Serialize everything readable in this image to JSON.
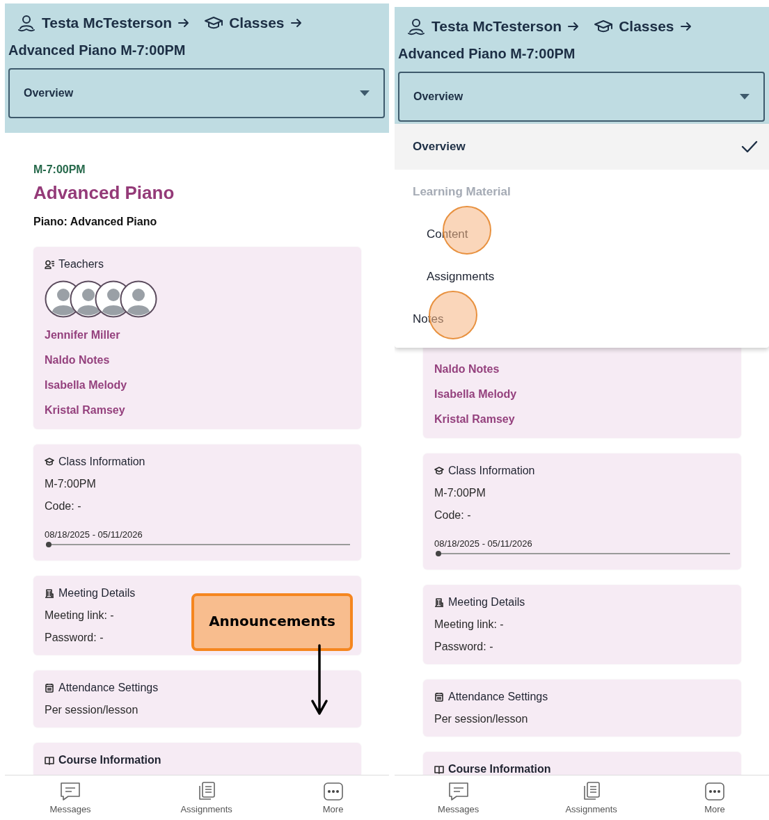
{
  "screens": [
    {
      "breadcrumb": [
        {
          "kind": "person",
          "label": "Testa McTesterson"
        },
        {
          "kind": "classes",
          "label": "Classes"
        }
      ],
      "page_title": "Advanced Piano M-7:00PM",
      "select": {
        "value": "Overview"
      },
      "class_time": "M-7:00PM",
      "class_title": "Advanced Piano",
      "subject": "Piano: Advanced Piano",
      "cards": [
        {
          "kind": "teachers",
          "title": "Teachers",
          "teachers": [
            "Jennifer Miller",
            "Naldo Notes",
            "Isabella Melody",
            "Kristal Ramsey"
          ]
        },
        {
          "kind": "class",
          "title": "Class Information",
          "lines": [
            "M-7:00PM",
            "Code: -"
          ],
          "date_range": "08/18/2025 - 05/11/2026",
          "level": 0.01
        },
        {
          "kind": "meeting",
          "title": "Meeting Details",
          "lines": [
            "Meeting link:  -",
            "Password: -"
          ]
        },
        {
          "kind": "attendance",
          "title": "Attendance Settings",
          "lines": [
            "Per session/lesson"
          ]
        },
        {
          "kind": "course",
          "title": "Course Information"
        }
      ],
      "callout": {
        "text": "Announcements"
      },
      "bottom_nav": [
        {
          "kind": "messages",
          "label": "Messages"
        },
        {
          "kind": "assignments",
          "label": "Assignments"
        },
        {
          "kind": "more",
          "label": "More"
        }
      ]
    },
    {
      "breadcrumb": [
        {
          "kind": "person",
          "label": "Testa McTesterson"
        },
        {
          "kind": "classes",
          "label": "Classes"
        }
      ],
      "page_title": "Advanced Piano M-7:00PM",
      "select": {
        "value": "Overview"
      },
      "menu": {
        "items": [
          {
            "kind": "option",
            "label": "Overview",
            "selected": true,
            "tapped": false
          },
          {
            "kind": "group",
            "label": "Learning Material",
            "children": [
              {
                "kind": "option",
                "label": "Content",
                "selected": false,
                "tapped": true
              },
              {
                "kind": "option",
                "label": "Assignments",
                "selected": false,
                "tapped": false
              }
            ]
          },
          {
            "kind": "option",
            "label": "Notes",
            "selected": false,
            "tapped": true
          }
        ]
      },
      "cards": [
        {
          "kind": "teachers",
          "teachers": [
            "Naldo Notes",
            "Isabella Melody",
            "Kristal Ramsey"
          ]
        },
        {
          "kind": "class",
          "title": "Class Information",
          "lines": [
            "M-7:00PM",
            "Code: -"
          ],
          "date_range": "08/18/2025 - 05/11/2026",
          "level": 0.01
        },
        {
          "kind": "meeting",
          "title": "Meeting Details",
          "lines": [
            "Meeting link:  -",
            "Password: -"
          ]
        },
        {
          "kind": "attendance",
          "title": "Attendance Settings",
          "lines": [
            "Per session/lesson"
          ]
        },
        {
          "kind": "course",
          "title": "Course Information"
        }
      ],
      "bottom_nav": [
        {
          "kind": "messages",
          "label": "Messages"
        },
        {
          "kind": "assignments",
          "label": "Assignments"
        },
        {
          "kind": "more",
          "label": "More"
        }
      ]
    }
  ]
}
